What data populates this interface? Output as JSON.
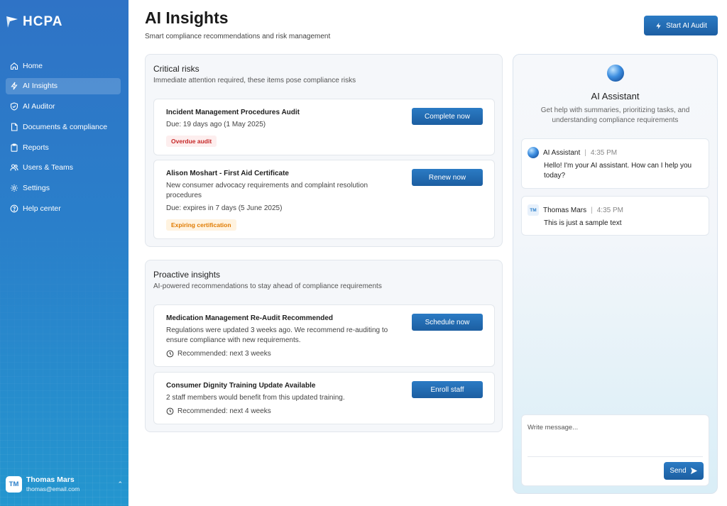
{
  "brand": {
    "name": "HCPA"
  },
  "sidebar": {
    "items": [
      {
        "label": "Home",
        "icon": "home-icon"
      },
      {
        "label": "AI Insights",
        "icon": "lightning-icon",
        "active": true
      },
      {
        "label": "AI Auditor",
        "icon": "shield-check-icon"
      },
      {
        "label": "Documents & compliance",
        "icon": "document-icon"
      },
      {
        "label": "Reports",
        "icon": "clipboard-icon"
      },
      {
        "label": "Users & Teams",
        "icon": "users-icon"
      },
      {
        "label": "Settings",
        "icon": "gear-icon"
      },
      {
        "label": "Help center",
        "icon": "help-icon"
      }
    ]
  },
  "user": {
    "initials": "TM",
    "name": "Thomas Mars",
    "email": "thomas@email.com"
  },
  "header": {
    "title": "AI Insights",
    "subtitle": "Smart compliance recommendations and risk management",
    "action_label": "Start AI Audit"
  },
  "critical": {
    "title": "Critical risks",
    "subtitle": "Immediate attention required, these items pose compliance risks",
    "items": [
      {
        "title": "Incident Management Procedures Audit",
        "due": "Due: 19 days ago (1 May 2025)",
        "badge": "Overdue audit",
        "button": "Complete now"
      },
      {
        "title": "Alison Moshart - First Aid Certificate",
        "description": "New consumer advocacy requirements and complaint resolution procedures",
        "due": "Due: expires in 7 days (5 June 2025)",
        "badge": "Expiring certification",
        "button": "Renew now"
      }
    ]
  },
  "proactive": {
    "title": "Proactive insights",
    "subtitle": "AI-powered recommendations to stay ahead of compliance requirements",
    "items": [
      {
        "title": "Medication Management Re-Audit Recommended",
        "description": "Regulations were updated 3 weeks ago. We recommend re-auditing to ensure compliance with new requirements.",
        "recommended": "Recommended: next 3 weeks",
        "button": "Schedule now"
      },
      {
        "title": "Consumer Dignity Training Update Available",
        "description": "2 staff members would benefit from this updated training.",
        "recommended": "Recommended: next 4 weeks",
        "button": "Enroll staff"
      }
    ]
  },
  "assistant": {
    "title": "AI Assistant",
    "subtitle": "Get help with summaries, prioritizing tasks, and understanding compliance requirements",
    "messages": [
      {
        "sender": "AI Assistant",
        "time": "4:35 PM",
        "text": "Hello! I'm your AI assistant. How can I help you today?"
      },
      {
        "sender": "Thomas Mars",
        "initials": "TM",
        "time": "4:35 PM",
        "text": "This is just a sample text"
      }
    ],
    "composer_placeholder": "Write message...",
    "send_label": "Send"
  }
}
